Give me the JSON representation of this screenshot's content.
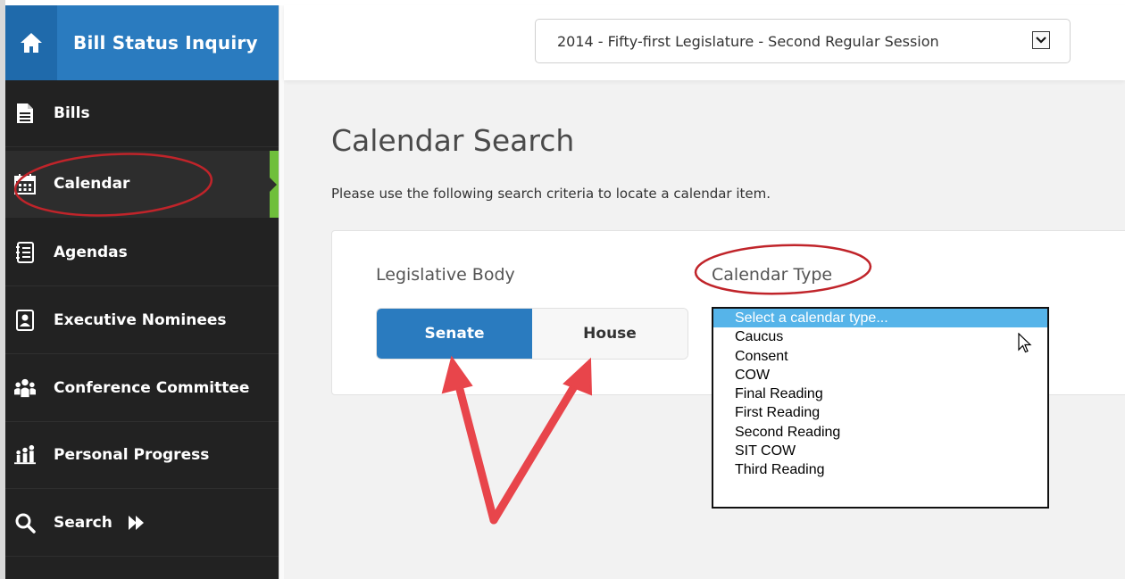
{
  "app": {
    "title": "Bill Status Inquiry"
  },
  "session": {
    "selected": "2014 - Fifty-first Legislature - Second Regular Session"
  },
  "sidebar": {
    "items": [
      {
        "label": "Bills",
        "icon": "document-icon"
      },
      {
        "label": "Calendar",
        "icon": "calendar-icon",
        "active": true
      },
      {
        "label": "Agendas",
        "icon": "agenda-icon"
      },
      {
        "label": "Executive Nominees",
        "icon": "nominees-icon"
      },
      {
        "label": "Conference Committee",
        "icon": "group-icon"
      },
      {
        "label": "Personal Progress",
        "icon": "progress-icon"
      },
      {
        "label": "Search",
        "icon": "search-icon"
      }
    ]
  },
  "main": {
    "title": "Calendar Search",
    "description": "Please use the following search criteria to locate a calendar item.",
    "legislative_body": {
      "label": "Legislative Body",
      "options": [
        "Senate",
        "House"
      ],
      "selected": "Senate"
    },
    "calendar_type": {
      "label": "Calendar Type",
      "options": [
        "Select a calendar type...",
        "Caucus",
        "Consent",
        "COW",
        "Final Reading",
        "First Reading",
        "Second Reading",
        "SIT COW",
        "Third Reading"
      ],
      "highlighted": "Select a calendar type..."
    }
  },
  "colors": {
    "brand": "#2a7bbf",
    "sidebar": "#222222",
    "active_marker": "#6fbf3b",
    "list_highlight": "#56b4e9",
    "annotation": "#c0242a",
    "arrow": "#e8454b"
  }
}
